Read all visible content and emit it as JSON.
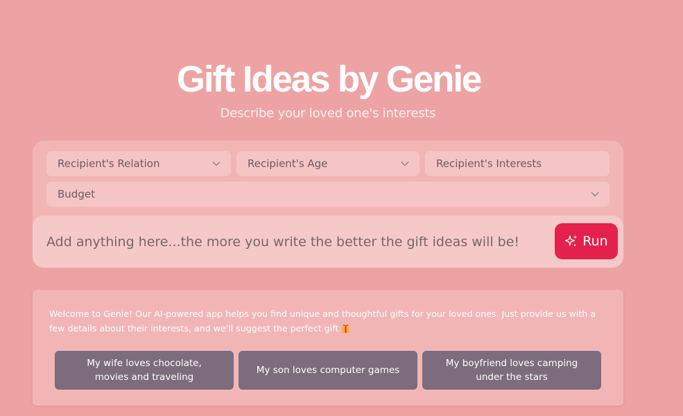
{
  "header": {
    "title": "Gift Ideas by Genie",
    "subtitle": "Describe your loved one's interests"
  },
  "form": {
    "relation": {
      "label": "Recipient's Relation",
      "icon": "chevron-down-icon"
    },
    "age": {
      "label": "Recipient's Age",
      "icon": "chevron-down-icon"
    },
    "interests": {
      "placeholder": "Recipient's Interests"
    },
    "budget": {
      "label": "Budget",
      "icon": "chevron-down-icon"
    },
    "prompt": {
      "placeholder": "Add anything here...the more you write the better the gift ideas will be!"
    },
    "run": {
      "label": "Run",
      "icon": "sparkle-icon"
    }
  },
  "info": {
    "welcome": "Welcome to Genie! Our AI-powered app helps you find unique and thoughtful gifts for your loved ones. Just provide us with a few details about their interests, and we'll suggest the perfect gift",
    "welcome_icon": "gift-icon",
    "examples": [
      "My wife loves chocolate, movies and traveling",
      "My son loves computer games",
      "My boyfriend loves camping under the stars"
    ]
  },
  "colors": {
    "background": "#eda3a4",
    "card": "#f2b5b6",
    "field": "#f5c5c5",
    "accent": "#e4214c",
    "example_button": "#7d6b7e"
  }
}
